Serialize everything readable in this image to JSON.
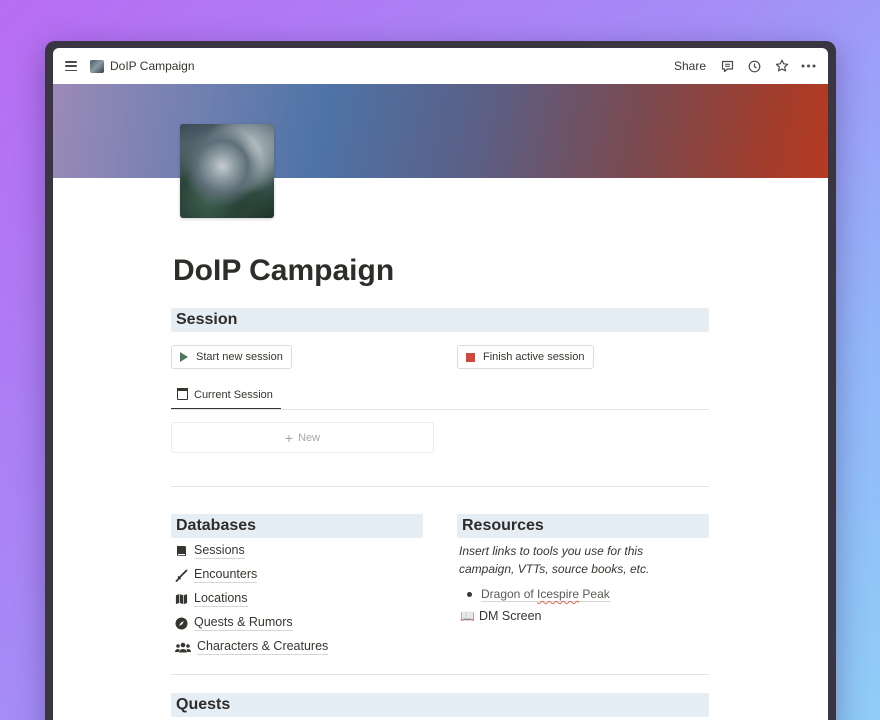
{
  "topbar": {
    "breadcrumb": "DoIP Campaign",
    "share_label": "Share"
  },
  "page": {
    "title": "DoIP Campaign"
  },
  "session": {
    "heading": "Session",
    "start_button": "Start new session",
    "finish_button": "Finish active session",
    "tab_label": "Current Session",
    "new_label": "New"
  },
  "databases": {
    "heading": "Databases",
    "items": [
      {
        "label": "Sessions",
        "icon": "book-icon"
      },
      {
        "label": "Encounters",
        "icon": "swords-icon"
      },
      {
        "label": "Locations",
        "icon": "map-icon"
      },
      {
        "label": "Quests & Rumors",
        "icon": "compass-icon"
      },
      {
        "label": "Characters & Creatures",
        "icon": "people-icon"
      }
    ]
  },
  "resources": {
    "heading": "Resources",
    "description": "Insert links to tools you use for this campaign, VTTs, source books, etc.",
    "link_pre": "Dragon of ",
    "link_misspelled": "Icespire",
    "link_post": " Peak",
    "dm_screen_emoji": "📖",
    "dm_screen_label": "DM Screen"
  },
  "quests": {
    "heading": "Quests"
  },
  "colors": {
    "heading_bg": "#e5eef5",
    "finish_square": "#d1483a",
    "play_triangle": "#4e7a5c"
  }
}
